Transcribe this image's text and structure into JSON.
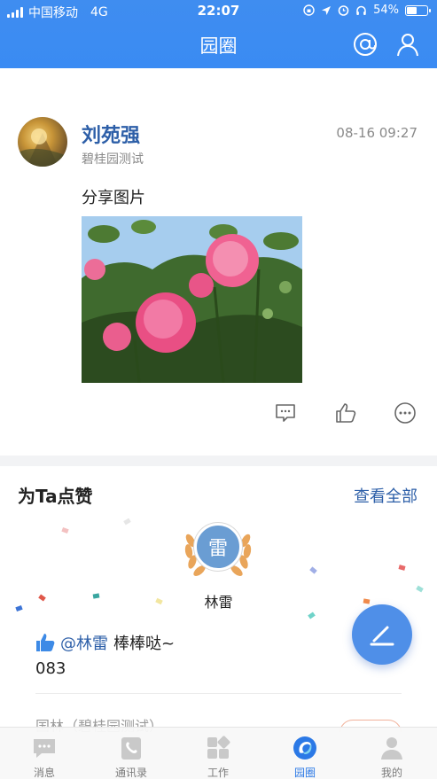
{
  "status_bar": {
    "carrier": "中国移动",
    "network": "4G",
    "time": "22:07",
    "battery_percent": "54%",
    "battery_level": 0.54
  },
  "header": {
    "title": "园圈",
    "at_icon": "at-icon",
    "profile_icon": "person-icon"
  },
  "post": {
    "author_name": "刘苑强",
    "author_org": "碧桂园测试",
    "timestamp": "08-16 09:27",
    "text": "分享图片",
    "image_subject": "pink roses",
    "actions": [
      "comment-icon",
      "like-icon",
      "more-icon"
    ]
  },
  "praise": {
    "title": "为Ta点赞",
    "see_all": "查看全部",
    "badge_char": "雷",
    "badge_name": "林雷",
    "mention": "@林雷",
    "message": "棒棒哒~",
    "number": "083",
    "next_entry": "国林（碧桂园测试）"
  },
  "tabbar": {
    "tabs": [
      {
        "label": "消息",
        "icon": "message-icon"
      },
      {
        "label": "通讯录",
        "icon": "contacts-icon"
      },
      {
        "label": "工作",
        "icon": "work-icon"
      },
      {
        "label": "园圈",
        "icon": "circle-icon"
      },
      {
        "label": "我的",
        "icon": "me-icon"
      }
    ],
    "active_index": 3
  },
  "colors": {
    "header_blue": "#3a8bf3",
    "name_blue": "#2d5fa8",
    "active_tab": "#2b79e6",
    "fab_blue": "#4f8fe8"
  }
}
